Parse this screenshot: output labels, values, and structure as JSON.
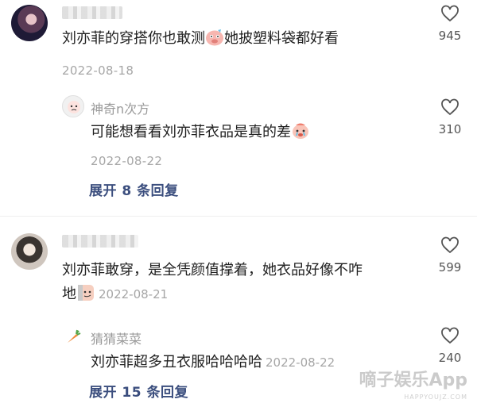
{
  "comments": [
    {
      "user": "",
      "text_a": "刘亦菲的穿搭你也敢测",
      "text_b": "她披塑料袋都好看",
      "date": "2022-08-18",
      "likes": "945",
      "emoji_icon": "pig-face-icon",
      "reply": {
        "user": "神奇n次方",
        "text": "可能想看看刘亦菲衣品是真的差",
        "date": "2022-08-22",
        "likes": "310",
        "emoji_icon": "crying-face-icon"
      },
      "expand_label": "展开 8 条回复"
    },
    {
      "user": "",
      "text_a": "刘亦菲敢穿，是全凭颜值撑着，她衣品好像不咋",
      "text_b": "地",
      "date": "2022-08-21",
      "likes": "599",
      "emoji_icon": "smirk-face-icon",
      "reply": {
        "user": "猜猜菜菜",
        "text": "刘亦菲超多丑衣服哈哈哈哈",
        "date": "2022-08-22",
        "likes": "240",
        "avatar_icon": "carrot-icon"
      },
      "expand_label": "展开 15 条回复"
    }
  ],
  "watermark": {
    "main": "嘀子娱乐App",
    "sub": "HAPPYOUJZ.COM"
  },
  "colors": {
    "link": "#3b4e7e",
    "meta": "#a6a6a6",
    "username": "#9a9a9a"
  }
}
